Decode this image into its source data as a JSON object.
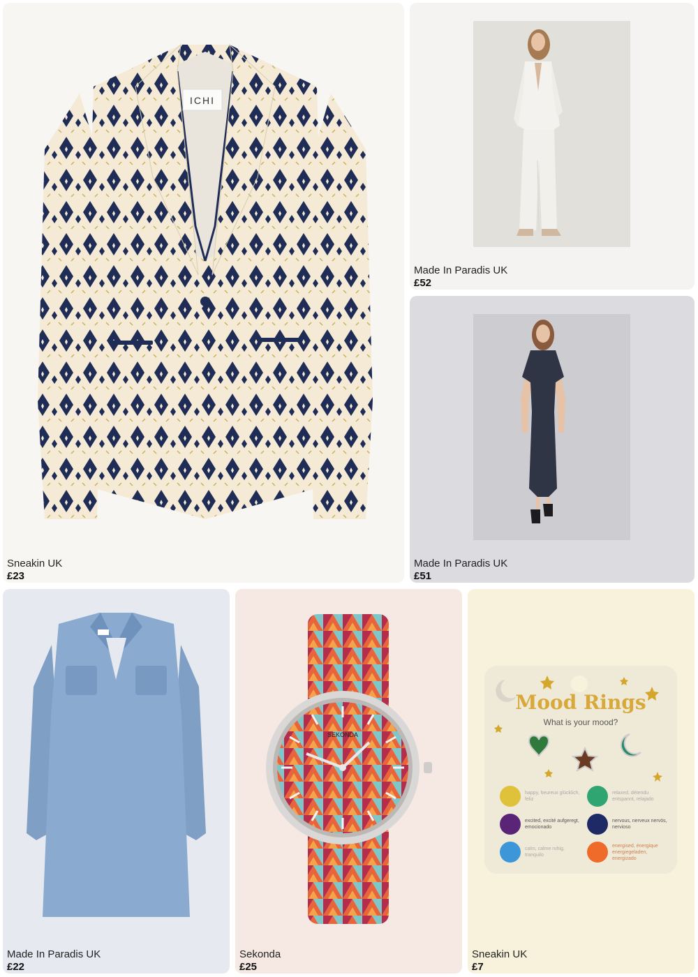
{
  "products": [
    {
      "store": "Sneakin UK",
      "price": "£23",
      "image": "ichi-patterned-blazer",
      "brand_tag": "ICHI",
      "bg": "#f8f6f2"
    },
    {
      "store": "Made In Paradis UK",
      "price": "£52",
      "image": "white-suit-model",
      "bg": "#f4f3f1"
    },
    {
      "store": "Made In Paradis UK",
      "price": "£51",
      "image": "navy-midi-dress-model",
      "bg": "#dcdbdf"
    },
    {
      "store": "Made In Paradis UK",
      "price": "£22",
      "image": "denim-shirt-dress",
      "bg": "#e6eaf0"
    },
    {
      "store": "Sekonda",
      "price": "£25",
      "image": "triangle-pattern-watch",
      "brand_tag": "SEKONDA",
      "bg": "#f6e8e2"
    },
    {
      "store": "Sneakin UK",
      "price": "£7",
      "image": "mood-rings-card",
      "bg": "#f8f2dc",
      "mood_card": {
        "title": "Mood Rings",
        "subtitle": "What is your mood?",
        "legend": [
          {
            "text": "happy, heureux glücklich, feliz",
            "color": "#e0c23a"
          },
          {
            "text": "relaxed, détendu entspannt, relajado",
            "color": "#2fa571"
          },
          {
            "text": "excited, excité aufgeregt, emocionado",
            "color": "#5b2577"
          },
          {
            "text": "nervous, nerveux nervös, nervioso",
            "color": "#1e2a66"
          },
          {
            "text": "calm, calme ruhig, tranquilo",
            "color": "#3d96d8"
          },
          {
            "text": "energised, énergique energiegeladen, energizado",
            "color": "#ee6b2a"
          }
        ]
      }
    }
  ]
}
